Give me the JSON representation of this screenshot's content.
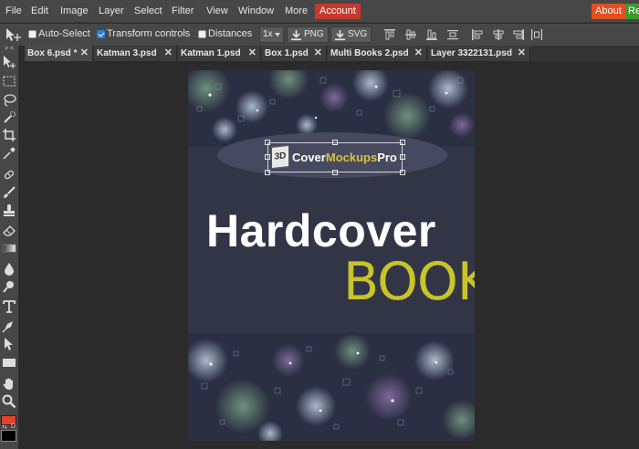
{
  "menu": {
    "items": [
      "File",
      "Edit",
      "Image",
      "Layer",
      "Select",
      "Filter",
      "View",
      "Window",
      "More"
    ],
    "account": "Account",
    "about": "About",
    "right_cut": "Re"
  },
  "options": {
    "auto_select": "Auto-Select",
    "auto_select_checked": false,
    "transform_controls": "Transform controls",
    "transform_controls_checked": true,
    "distances": "Distances",
    "distances_checked": false,
    "scale": "1x",
    "export_png": "PNG",
    "export_svg": "SVG"
  },
  "tabs": [
    {
      "label": "Box 6.psd *",
      "close": "✕"
    },
    {
      "label": "Katman 3.psd",
      "close": "✕"
    },
    {
      "label": "Katman 1.psd",
      "close": "✕"
    },
    {
      "label": "Box 1.psd",
      "close": "✕"
    },
    {
      "label": "Multi Books 2.psd",
      "close": "✕"
    },
    {
      "label": "Layer 3322131.psd",
      "close": "✕"
    }
  ],
  "toolbar": {
    "collapse": "> <",
    "tools": [
      "move-tool-icon",
      "marquee-tool-icon",
      "lasso-tool-icon",
      "quick-select-icon",
      "crop-tool-icon",
      "eyedropper-icon",
      "healing-brush-icon",
      "brush-tool-icon",
      "clone-stamp-icon",
      "eraser-icon",
      "gradient-tool-icon",
      "blur-tool-icon",
      "dodge-tool-icon",
      "type-tool-icon",
      "pen-tool-icon",
      "path-select-icon",
      "shape-tool-icon",
      "hand-tool-icon",
      "zoom-tool-icon"
    ],
    "fg_color": "#e3422b",
    "bg_color": "#000000",
    "swap_label": "D"
  },
  "canvas": {
    "logo_3d": "3D",
    "logo_word1": "Cover",
    "logo_word2": "Mockups",
    "logo_word3": "Pro",
    "title_line1": "Hardcover",
    "title_line2": "BOOK",
    "title_line2_color": "#c8c42a",
    "bg_color": "#323546"
  }
}
